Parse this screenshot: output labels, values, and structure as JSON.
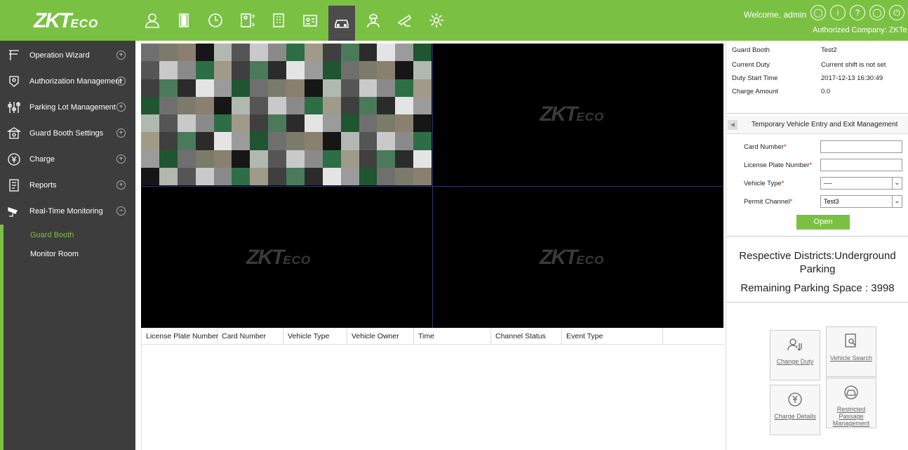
{
  "brand": {
    "logo_main": "ZKT",
    "logo_suffix": "ECO"
  },
  "header": {
    "nav_icons": [
      "personnel-icon",
      "door-icon",
      "clock-icon",
      "elevator-icon",
      "building-icon",
      "visitor-icon",
      "car-icon",
      "guard-icon",
      "patrol-icon",
      "settings-icon"
    ],
    "active_icon": "car-icon",
    "welcome": "Welcome, admin",
    "company": "Authorized Company: ZKTe"
  },
  "sidebar": {
    "items": [
      {
        "label": "Operation Wizard",
        "icon": "wizard-icon",
        "toggle": "+"
      },
      {
        "label": "Authorization Management",
        "icon": "authorization-icon",
        "toggle": "+"
      },
      {
        "label": "Parking Lot Management",
        "icon": "parking-lot-icon",
        "toggle": "+"
      },
      {
        "label": "Guard Booth Settings",
        "icon": "guard-booth-icon",
        "toggle": "+"
      },
      {
        "label": "Charge",
        "icon": "charge-icon",
        "toggle": "+"
      },
      {
        "label": "Reports",
        "icon": "reports-icon",
        "toggle": "+"
      },
      {
        "label": "Real-Time Monitoring",
        "icon": "monitoring-icon",
        "toggle": "−"
      }
    ],
    "subitems": [
      {
        "label": "Guard Booth",
        "active": true
      },
      {
        "label": "Monitor Room",
        "active": false
      }
    ]
  },
  "table": {
    "columns": [
      "License Plate Number",
      "Card Number",
      "Vehicle Type",
      "Vehicle Owner",
      "Time",
      "Channel Status",
      "Event Type"
    ]
  },
  "booth_info": {
    "rows": [
      {
        "label": "Guard Booth",
        "value": "Test2"
      },
      {
        "label": "Current Duty",
        "value": "Current shift is not set"
      },
      {
        "label": "Duty Start Time",
        "value": "2017-12-13 16:30:49"
      },
      {
        "label": "Charge Amount",
        "value": "0.0"
      }
    ]
  },
  "entry_form": {
    "title": "Temporary Vehicle Entry and Exit Management",
    "card_number_label": "Card Number",
    "card_number_value": "",
    "plate_label": "License Plate Number",
    "plate_value": "",
    "vehicle_type_label": "Vehicle Type",
    "vehicle_type_value": "----",
    "permit_channel_label": "Permit Channel",
    "permit_channel_value": "Test3",
    "open_label": "Open"
  },
  "district": {
    "line1": "Respective Districts:Underground",
    "line2": "Parking",
    "remaining": "Remaining Parking Space : 3998"
  },
  "actions": [
    {
      "label": "Change Duty",
      "icon": "change-duty-icon"
    },
    {
      "label": "Vehicle Search",
      "icon": "vehicle-search-icon"
    },
    {
      "label": "Charge Details",
      "icon": "charge-details-icon"
    },
    {
      "label": "Restricted Passage Management",
      "icon": "restricted-passage-icon"
    }
  ]
}
